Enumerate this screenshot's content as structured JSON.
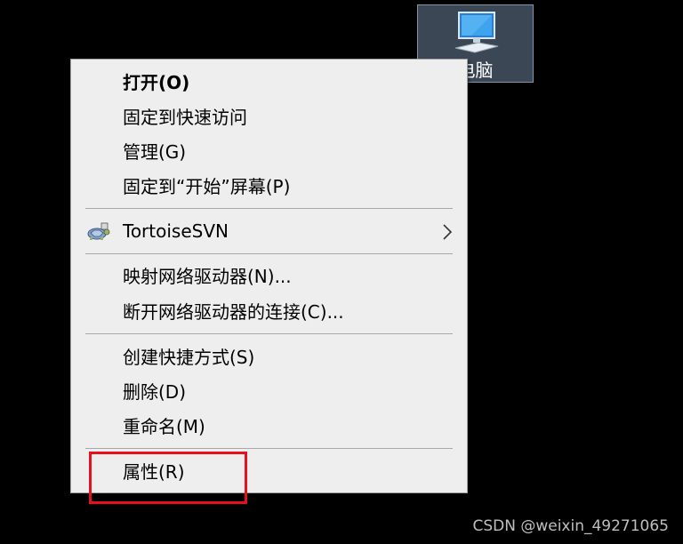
{
  "desktop_icon": {
    "label": "电脑",
    "icon": "computer-icon"
  },
  "context_menu": {
    "items": [
      {
        "label": "打开(O)",
        "bold": true
      },
      {
        "label": "固定到快速访问"
      },
      {
        "label": "管理(G)"
      },
      {
        "label": "固定到“开始”屏幕(P)"
      },
      {
        "label": "TortoiseSVN",
        "icon": "tortoisesvn-icon",
        "submenu": true
      },
      {
        "label": "映射网络驱动器(N)..."
      },
      {
        "label": "断开网络驱动器的连接(C)..."
      },
      {
        "label": "创建快捷方式(S)"
      },
      {
        "label": "删除(D)"
      },
      {
        "label": "重命名(M)"
      },
      {
        "label": "属性(R)"
      }
    ]
  },
  "highlight_color": "#e8101b",
  "watermark": "CSDN @weixin_49271065"
}
